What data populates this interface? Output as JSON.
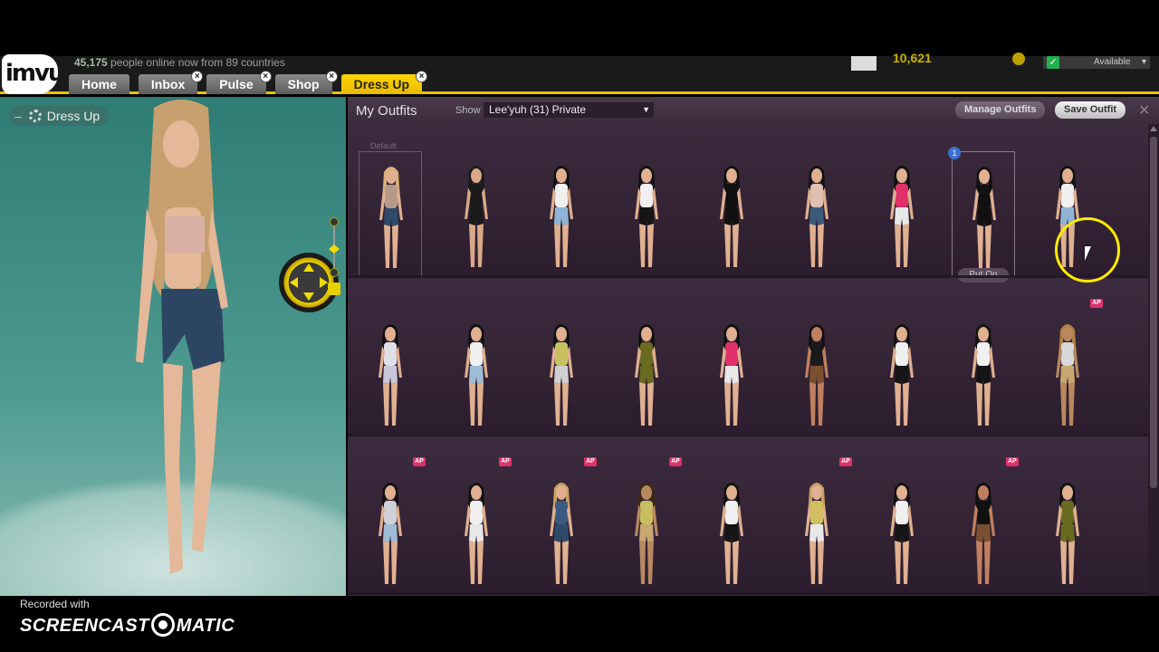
{
  "header": {
    "logo_text": "imvu",
    "online_count": "45,175",
    "online_suffix": " people online now from 89 countries",
    "credits": "10,621",
    "status": "Available"
  },
  "tabs": [
    {
      "label": "Home",
      "closable": false,
      "active": false
    },
    {
      "label": "Inbox",
      "closable": true,
      "active": false
    },
    {
      "label": "Pulse",
      "closable": true,
      "active": false
    },
    {
      "label": "Shop",
      "closable": true,
      "active": false
    },
    {
      "label": "Dress Up",
      "closable": true,
      "active": true
    }
  ],
  "stage": {
    "label": "Dress Up",
    "minimize": "–"
  },
  "panel": {
    "title": "My Outfits",
    "show_label": "Show",
    "show_value": "Lee'yuh (31) Private",
    "manage_btn": "Manage Outfits",
    "save_btn": "Save Outfit",
    "close_glyph": "✕",
    "default_label": "Default",
    "badge_number": "1",
    "put_on_label": "Put On",
    "ap_label": "AP"
  },
  "outfits": [
    [
      {
        "top": "#b59a8a",
        "bottom": "#2e4a6a",
        "hair": "#d9b27a",
        "skin": "#e0b090",
        "kind": "default"
      },
      {
        "top": "#1a1a1a",
        "bottom": "#1a1a1a",
        "hair": "#1a1a1a",
        "skin": "#d8a888"
      },
      {
        "top": "#f0f0f0",
        "bottom": "#8fb4d6",
        "hair": "#111",
        "skin": "#e0b090"
      },
      {
        "top": "#f0f0f0",
        "bottom": "#151515",
        "hair": "#111",
        "skin": "#e0b090"
      },
      {
        "top": "#111",
        "bottom": "#111",
        "hair": "#111",
        "skin": "#e0b090"
      },
      {
        "top": "#e0c0b0",
        "bottom": "#3a5a7a",
        "hair": "#111",
        "skin": "#e0b090"
      },
      {
        "top": "#e0306a",
        "bottom": "#e8e8e8",
        "hair": "#111",
        "skin": "#e0b090"
      },
      {
        "top": "#111",
        "bottom": "#111",
        "hair": "#111",
        "skin": "#e0b090",
        "kind": "selected"
      },
      {
        "top": "#f0f0f0",
        "bottom": "#8fb4d6",
        "hair": "#111",
        "skin": "#e0b090"
      }
    ],
    [
      {
        "top": "#e0e0e8",
        "bottom": "#c8c8d8",
        "hair": "#111",
        "skin": "#e0b090"
      },
      {
        "top": "#f0f0f0",
        "bottom": "#9fbcd6",
        "hair": "#111",
        "skin": "#e0b090"
      },
      {
        "top": "#c8c060",
        "bottom": "#d0d0d0",
        "hair": "#111",
        "skin": "#e0b090"
      },
      {
        "top": "#6a6a20",
        "bottom": "#6a6a20",
        "hair": "#111",
        "skin": "#e0b090"
      },
      {
        "top": "#e0306a",
        "bottom": "#e8e8e8",
        "hair": "#111",
        "skin": "#e0b090"
      },
      {
        "top": "#1a1a1a",
        "bottom": "#7a5030",
        "hair": "#111",
        "skin": "#c08060"
      },
      {
        "top": "#f0f0f0",
        "bottom": "#151515",
        "hair": "#111",
        "skin": "#e0b090"
      },
      {
        "top": "#f0f0f0",
        "bottom": "#151515",
        "hair": "#111",
        "skin": "#e0b090"
      },
      {
        "top": "#d8d8d8",
        "bottom": "#c8a870",
        "hair": "#b08040",
        "skin": "#b88860",
        "ap": true
      }
    ],
    [
      {
        "top": "#d0d0d8",
        "bottom": "#9fbcd6",
        "hair": "#111",
        "skin": "#e0b090",
        "ap": true
      },
      {
        "top": "#f0f0f0",
        "bottom": "#e8e8e8",
        "hair": "#111",
        "skin": "#e0b090",
        "ap": true
      },
      {
        "top": "#3a5a80",
        "bottom": "#2e4a6a",
        "hair": "#c8a060",
        "skin": "#e0b090",
        "ap": true
      },
      {
        "top": "#c8c060",
        "bottom": "#c8a870",
        "hair": "#3a2a10",
        "skin": "#b88860",
        "ap": true
      },
      {
        "top": "#f0f0f0",
        "bottom": "#151515",
        "hair": "#111",
        "skin": "#e0b090"
      },
      {
        "top": "#d0c060",
        "bottom": "#e8e8e8",
        "hair": "#c8a060",
        "skin": "#e0b090",
        "ap": true
      },
      {
        "top": "#f0f0f0",
        "bottom": "#151515",
        "hair": "#111",
        "skin": "#e0b090"
      },
      {
        "top": "#111",
        "bottom": "#7a5030",
        "hair": "#111",
        "skin": "#c08060",
        "ap": true
      },
      {
        "top": "#6a6a20",
        "bottom": "#6a6a20",
        "hair": "#111",
        "skin": "#e0b090"
      }
    ]
  ],
  "footer": {
    "recorded_with": "Recorded with",
    "brand_left": "SCREENCAST",
    "brand_right": "MATIC"
  }
}
